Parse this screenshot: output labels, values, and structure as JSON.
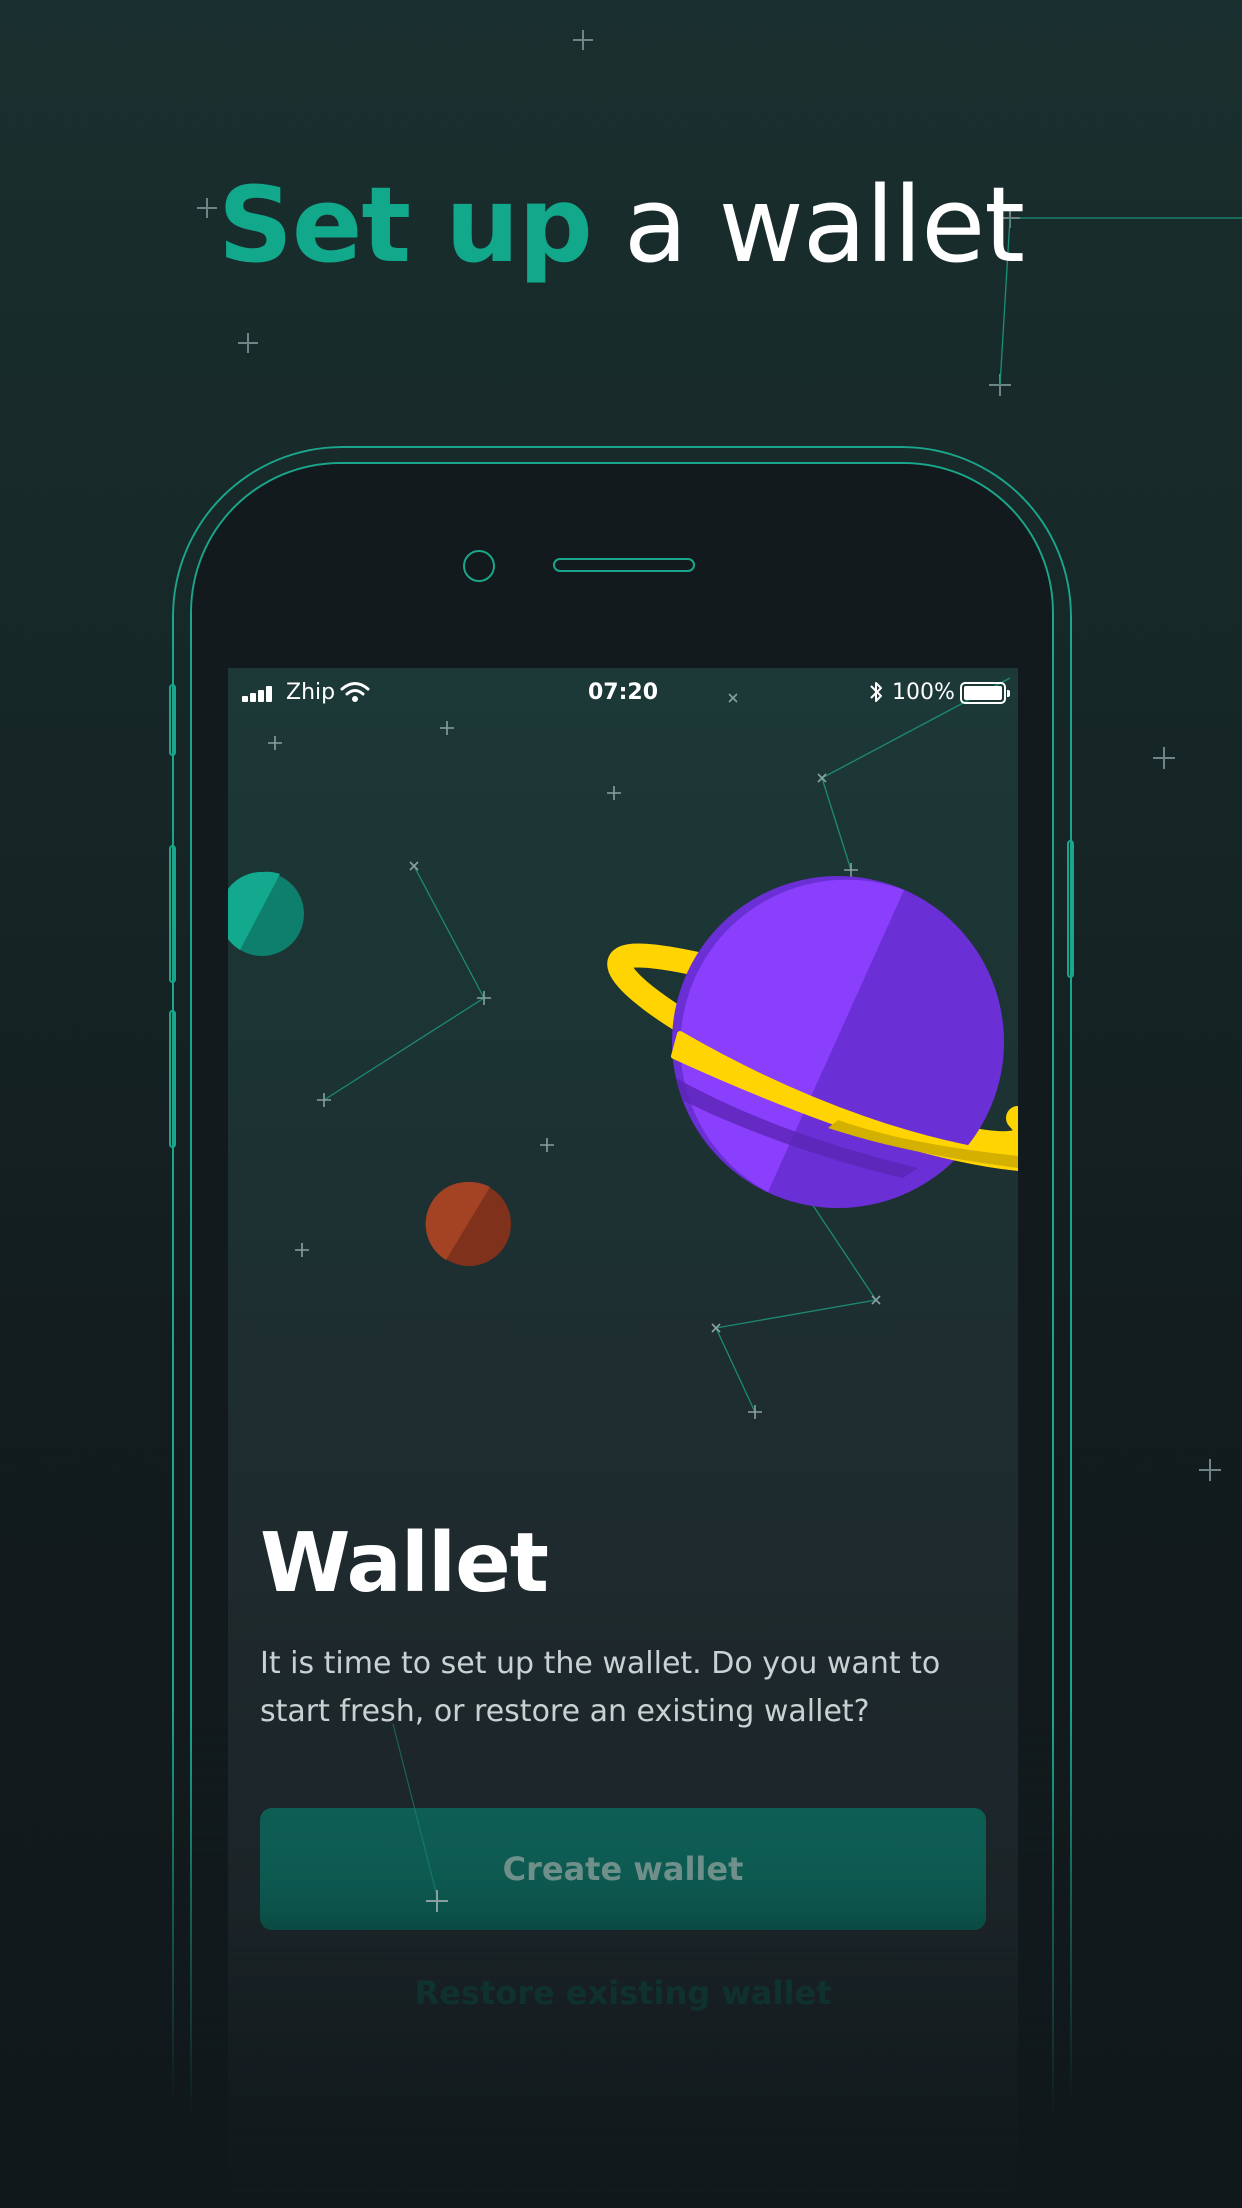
{
  "headline": {
    "accent": "Set up",
    "rest": "a wallet"
  },
  "status_bar": {
    "carrier": "Zhip",
    "time": "07:20",
    "battery": "100%",
    "icons": [
      "signal-icon",
      "wifi-icon",
      "bluetooth-icon",
      "battery-icon"
    ]
  },
  "screen": {
    "title": "Wallet",
    "description": "It is time to set up the wallet. Do you want to start fresh, or restore an existing wallet?",
    "create_button": "Create wallet",
    "restore_button": "Restore existing wallet"
  },
  "colors": {
    "accent": "#12a88c",
    "background": "#162626",
    "planet_purple": "#7b3ff2",
    "ring_yellow": "#ffd400",
    "planet_teal": "#12a88c",
    "planet_orange": "#a23f1f"
  }
}
